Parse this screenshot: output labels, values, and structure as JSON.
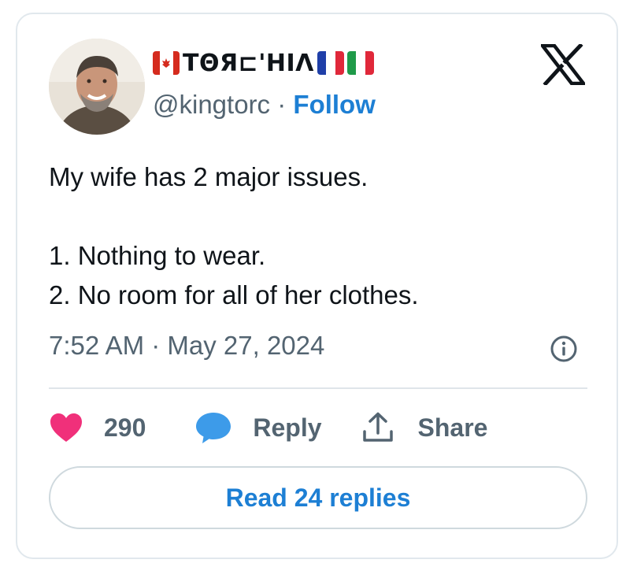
{
  "tweet": {
    "author": {
      "display_name_text": "ТΘЯ⊏'HIΛ",
      "flags": [
        "flag-canada-icon",
        "flag-france-icon",
        "flag-italy-icon"
      ],
      "handle": "@kingtorc",
      "separator": "·",
      "follow_label": "Follow"
    },
    "text_lines": [
      "My wife has 2 major issues.",
      "",
      "1. Nothing to wear.",
      "2. No room for all of her clothes."
    ],
    "timestamp": "7:52 AM · May 27, 2024",
    "actions": {
      "like_count": "290",
      "reply_label": "Reply",
      "share_label": "Share"
    },
    "read_replies_label": "Read 24 replies"
  },
  "icons": {
    "brand": "x-logo-icon",
    "info": "info-icon",
    "like": "heart-icon",
    "reply": "speech-bubble-icon",
    "share": "share-upload-icon"
  },
  "colors": {
    "link_blue": "#1d7fd4",
    "heart_pink": "#f0307a",
    "reply_blue": "#3d9be9",
    "muted_text": "#536471",
    "border": "#e1e8ed"
  }
}
